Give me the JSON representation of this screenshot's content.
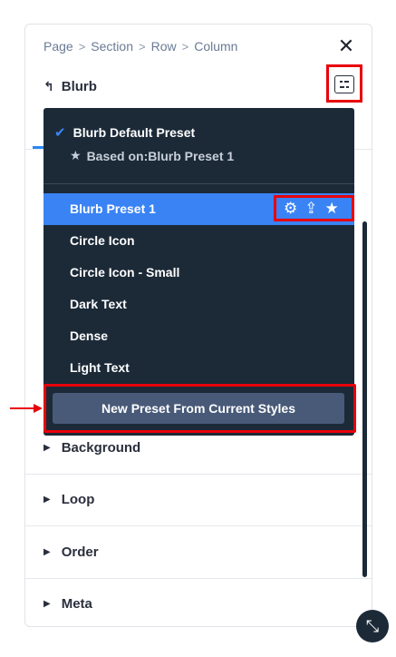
{
  "breadcrumb": [
    "Page",
    "Section",
    "Row",
    "Column"
  ],
  "breadcrumb_separator": ">",
  "header": {
    "back_icon": "↰",
    "title": "Blurb",
    "close_icon": "✕"
  },
  "preset_menu": {
    "default_preset": "Blurb Default Preset",
    "based_on": "Based on:Blurb Preset 1",
    "items": [
      {
        "label": "Blurb Preset 1",
        "active": true
      },
      {
        "label": "Circle Icon"
      },
      {
        "label": "Circle Icon - Small"
      },
      {
        "label": "Dark Text"
      },
      {
        "label": "Dense"
      },
      {
        "label": "Light Text"
      }
    ],
    "new_preset_button": "New Preset From Current Styles",
    "active_color": "#3a83f4",
    "menu_bg": "#1c2a38"
  },
  "sections": [
    {
      "label": "Background"
    },
    {
      "label": "Loop"
    },
    {
      "label": "Order"
    },
    {
      "label": "Meta"
    }
  ],
  "highlight_color": "#e8000b"
}
